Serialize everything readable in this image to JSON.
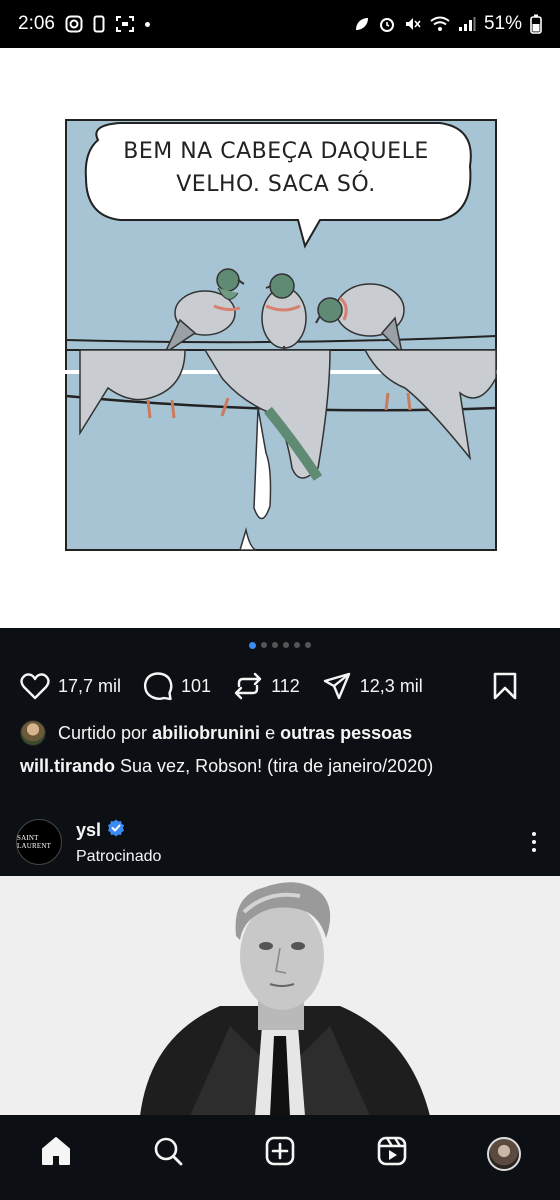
{
  "status_bar": {
    "time": "2:06",
    "battery": "51%"
  },
  "comic": {
    "speech_line1": "BEM NA CABEÇA DAQUELE",
    "speech_line2": "VELHO. SACA SÓ."
  },
  "carousel": {
    "count": 6,
    "active_index": 0
  },
  "actions": {
    "likes": "17,7 mil",
    "comments": "101",
    "reposts": "112",
    "shares": "12,3 mil"
  },
  "liked_by": {
    "prefix": "Curtido por",
    "user": "abiliobrunini",
    "connector": "e",
    "others": "outras pessoas"
  },
  "caption": {
    "username": "will.tirando",
    "text": "Sua vez, Robson! (tira de janeiro/2020)"
  },
  "sponsored": {
    "avatar_text": "SAINT LAURENT",
    "username": "ysl",
    "label": "Patrocinado"
  },
  "icons": {
    "like": "heart-icon",
    "comment": "comment-icon",
    "repost": "repost-icon",
    "share": "send-icon",
    "save": "bookmark-icon",
    "nav": [
      "home-icon",
      "search-icon",
      "create-icon",
      "reels-icon",
      "profile-avatar"
    ]
  },
  "colors": {
    "accent": "#3d8bf2",
    "background": "#0c1014",
    "comic_sky": "#a7c4d4"
  }
}
